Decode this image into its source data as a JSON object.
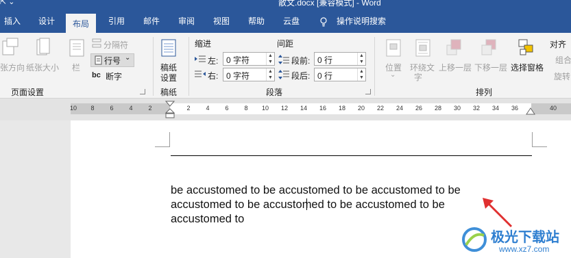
{
  "titlebar": {
    "title": "散文.docx [兼容模式] - Word",
    "quick_access": "⇱ ⌄"
  },
  "tabs": [
    {
      "label": "插入"
    },
    {
      "label": "设计"
    },
    {
      "label": "布局"
    },
    {
      "label": "引用"
    },
    {
      "label": "邮件"
    },
    {
      "label": "审阅"
    },
    {
      "label": "视图"
    },
    {
      "label": "帮助"
    },
    {
      "label": "云盘"
    },
    {
      "label": "操作说明搜索"
    }
  ],
  "ribbon": {
    "page_setup": {
      "orientation_label": "张方向",
      "size_label": "纸张大小",
      "columns_label": "栏",
      "breaks_label": "分隔符",
      "line_numbers_label": "行号",
      "hyphenation_label": "断字",
      "group_label": "页面设置"
    },
    "manuscript": {
      "button_label_1": "稿纸",
      "button_label_2": "设置",
      "group_label": "稿纸"
    },
    "paragraph": {
      "indent_title": "缩进",
      "spacing_title": "间距",
      "left_label": "左:",
      "right_label": "右:",
      "left_value": "0 字符",
      "right_value": "0 字符",
      "before_label": "段前:",
      "after_label": "段后:",
      "before_value": "0 行",
      "after_value": "0 行",
      "group_label": "段落"
    },
    "arrange": {
      "position_label": "位置",
      "wrap_label_1": "环绕文",
      "wrap_label_2": "字",
      "bring_forward_label": "上移一层",
      "send_backward_label": "下移一层",
      "selection_pane_label": "选择窗格",
      "align_label": "对齐",
      "group_label_short": "组合",
      "rotate_label": "旋转",
      "group_label": "排列"
    }
  },
  "ruler": {
    "ticks": [
      "10",
      "8",
      "6",
      "4",
      "2",
      "2",
      "4",
      "6",
      "8",
      "10",
      "12",
      "14",
      "16",
      "18",
      "20",
      "22",
      "24",
      "26",
      "28",
      "30",
      "32",
      "34",
      "36",
      "40"
    ]
  },
  "document": {
    "line1": "be accustomed to be accustomed to be accustomed to be",
    "line2": "accustomed to be accustomed to be accustomed to be",
    "line3": "accustomed to"
  },
  "watermark": {
    "site_name": "极光下载站",
    "url": "www.xz7.com"
  },
  "colors": {
    "accent": "#2b579a",
    "arrow": "#e03030"
  }
}
